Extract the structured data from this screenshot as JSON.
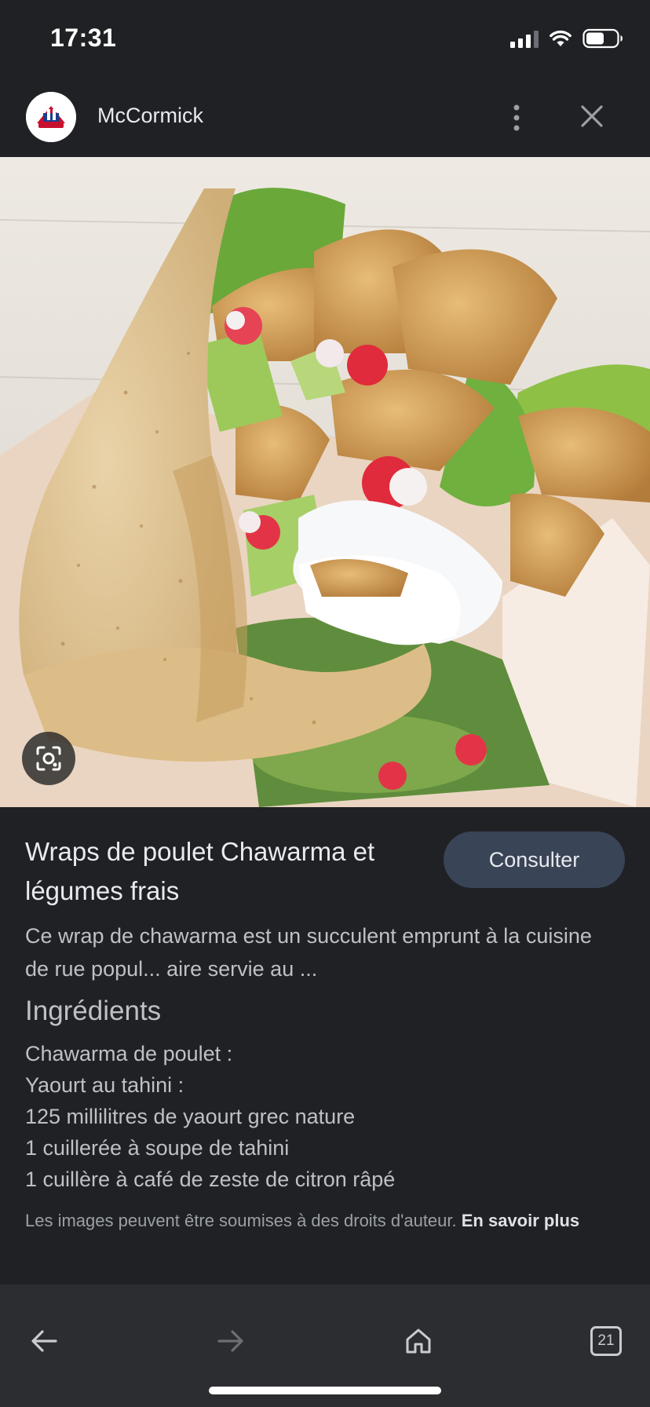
{
  "status_bar": {
    "time": "17:31",
    "icons": [
      "cellular-signal-icon",
      "wifi-icon",
      "battery-icon"
    ]
  },
  "header": {
    "site_name": "McCormick",
    "icons": [
      "mccormick-logo",
      "more-vert-icon",
      "close-icon"
    ]
  },
  "image": {
    "description_icon": "google-lens-icon"
  },
  "result": {
    "title": "Wraps de poulet Chawarma et légumes frais",
    "consult_label": "Consulter",
    "description": "Ce wrap de chawarma est un succulent emprunt à la cuisine de rue popul... aire servie au ...",
    "ingredients_heading": "Ingrédients",
    "ingredients": [
      "Chawarma de poulet :",
      "Yaourt au tahini :",
      "125 millilitres de yaourt grec nature",
      "1 cuillerée à soupe de tahini",
      "1 cuillère à café de zeste de citron râpé"
    ],
    "copyright_text": "Les images peuvent être soumises à des droits d'auteur.",
    "learn_more": "En savoir plus"
  },
  "bottom_nav": {
    "tab_count": "21",
    "icons": [
      "back-arrow-icon",
      "forward-arrow-icon",
      "home-icon",
      "tabs-icon"
    ]
  },
  "colors": {
    "background": "#202124",
    "nav_background": "#2c2d31",
    "button_background": "#394457",
    "primary_text": "#e8eaed",
    "secondary_text": "#bdc1c6"
  }
}
